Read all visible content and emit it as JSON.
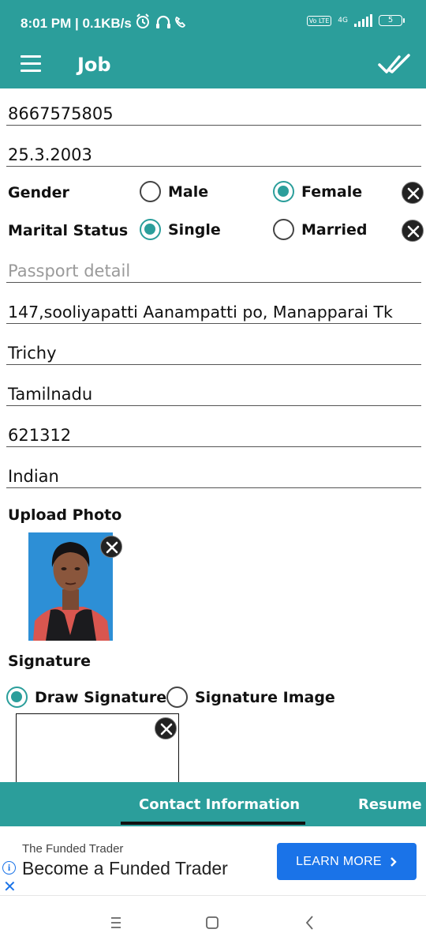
{
  "status": {
    "time": "8:01 PM | 0.1KB/s",
    "volte": "Vo LTE",
    "network": "4G",
    "battery": "5"
  },
  "appbar": {
    "title": "Job",
    "icons": [
      "menu-icon",
      "double-check-icon"
    ]
  },
  "form": {
    "phone": "8667575805",
    "dob": "25.3.2003",
    "gender": {
      "label": "Gender",
      "options": [
        "Male",
        "Female"
      ],
      "selected": "Female"
    },
    "marital_status": {
      "label": "Marital Status",
      "options": [
        "Single",
        "Married"
      ],
      "selected": "Single"
    },
    "passport_placeholder": "Passport detail",
    "address": "147,sooliyapatti Aanampatti po, Manapparai Tk",
    "city": "Trichy",
    "state": "Tamilnadu",
    "pincode": "621312",
    "nationality": "Indian",
    "upload_photo_label": "Upload Photo",
    "signature_label": "Signature",
    "signature_options": [
      "Draw Signature",
      "Signature Image"
    ],
    "signature_selected": "Draw Signature"
  },
  "tabs": [
    "Contact Information",
    "Resume H"
  ],
  "active_tab": "Contact Information",
  "ad": {
    "advertiser": "The Funded Trader",
    "headline": "Become a Funded Trader",
    "cta": "LEARN MORE"
  },
  "colors": {
    "primary": "#2b9e9b",
    "ad_button": "#1a73e8"
  }
}
